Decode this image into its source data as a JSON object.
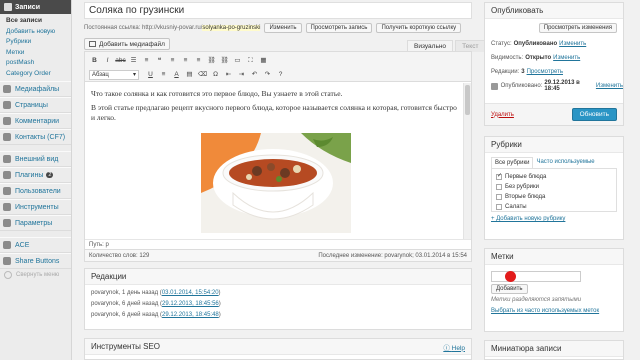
{
  "sidebar": {
    "header": "Записи",
    "submenu": [
      "Все записи",
      "Добавить новую",
      "Рубрики",
      "Метки",
      "postMash",
      "Category Order"
    ],
    "items": [
      {
        "label": "Медиафайлы",
        "icon": "media-icon"
      },
      {
        "label": "Страницы",
        "icon": "pages-icon"
      },
      {
        "label": "Комментарии",
        "icon": "comments-icon"
      },
      {
        "label": "Контакты (CF7)",
        "icon": "contacts-icon"
      },
      {
        "label": "Внешний вид",
        "icon": "appearance-icon"
      },
      {
        "label": "Плагины",
        "icon": "plugins-icon",
        "badge": "2"
      },
      {
        "label": "Пользователи",
        "icon": "users-icon"
      },
      {
        "label": "Инструменты",
        "icon": "tools-icon"
      },
      {
        "label": "Параметры",
        "icon": "settings-icon"
      },
      {
        "label": "ACE",
        "icon": "ace-icon"
      },
      {
        "label": "Share Buttons",
        "icon": "share-icon"
      }
    ],
    "collapse": "Свернуть меню"
  },
  "post": {
    "title": "Соляка по грузински",
    "permalink_label": "Постоянная ссылка:",
    "permalink_base": "http://vkusniy-povar.ru/",
    "permalink_slug": "solyanka-po-gruzinski",
    "btn_change": "Изменить",
    "btn_view": "Просмотреть запись",
    "btn_shortlink": "Получить короткую ссылку",
    "add_media": "Добавить медиафайл",
    "tab_visual": "Визуально",
    "tab_text": "Текст",
    "format_select": "Абзац",
    "content_p1": "Что такое солянка и как готовится это первое блюдо, Вы узнаете в этой статье.",
    "content_p2": "В этой статье предлагаю рецепт вкусного первого блюда, которое называется солянка и которая, готовится быстро и легко.",
    "path": "Путь: p",
    "word_count": "Количество слов: 129",
    "last_edit": "Последнее изменение: povarynok; 03.01.2014 в 15:54"
  },
  "revisions": {
    "title": "Редакции",
    "items": [
      {
        "text": "povarynok, 1 день назад",
        "link": "03.01.2014, 15:54:20"
      },
      {
        "text": "povarynok, 6 дней назад",
        "link": "29.12.2013, 18:45:56"
      },
      {
        "text": "povarynok, 6 дней назад",
        "link": "29.12.2013, 18:45:48"
      }
    ]
  },
  "seo": {
    "title": "Инструменты SEO",
    "help": "Help"
  },
  "publish": {
    "title": "Опубликовать",
    "preview_changes": "Просмотреть изменения",
    "status_label": "Статус:",
    "status_value": "Опубликовано",
    "visibility_label": "Видимость:",
    "visibility_value": "Открыто",
    "revisions_label": "Редакции:",
    "revisions_value": "3",
    "revisions_link": "Просмотреть",
    "published_label": "Опубликовано:",
    "published_value": "29.12.2013 в 18:45",
    "change": "Изменить",
    "delete": "Удалить",
    "update": "Обновить"
  },
  "categories": {
    "title": "Рубрики",
    "tab_all": "Все рубрики",
    "tab_popular": "Часто используемые",
    "items": [
      {
        "label": "Первые блюда",
        "checked": true
      },
      {
        "label": "Без рубрики",
        "checked": false
      },
      {
        "label": "Вторые блюда",
        "checked": false
      },
      {
        "label": "Салаты",
        "checked": false
      }
    ],
    "add_new": "+ Добавить новую рубрику"
  },
  "tags": {
    "title": "Метки",
    "add": "Добавить",
    "hint": "Метки разделяются запятыми",
    "choose": "Выбрать из часто используемых меток"
  },
  "thumbnail": {
    "title": "Миниатюра записи"
  },
  "colors": {
    "accent": "#21759b",
    "primary": "#2a95c5",
    "danger": "#bc0b0b",
    "admin_bar": "#4a4a4a"
  }
}
